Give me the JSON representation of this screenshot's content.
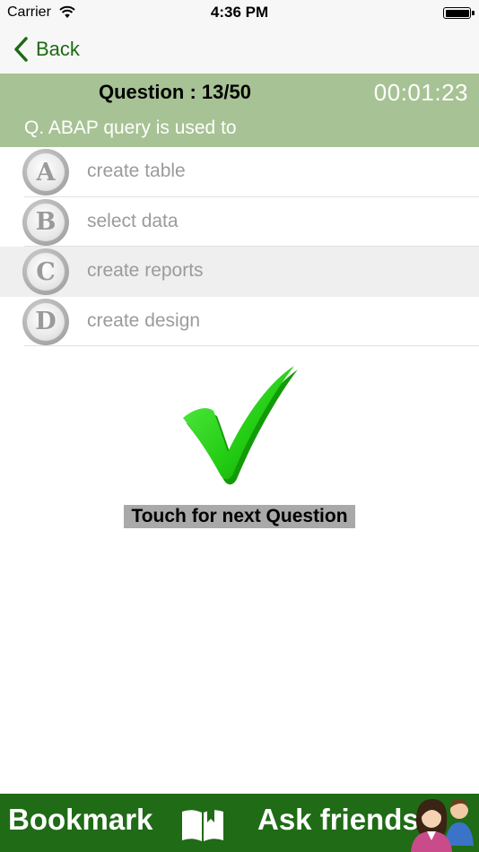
{
  "status_bar": {
    "carrier": "Carrier",
    "time": "4:36 PM",
    "icons": [
      "wifi-icon",
      "battery-icon"
    ]
  },
  "nav": {
    "back_label": "Back",
    "accent_color": "#1c6b13"
  },
  "header": {
    "counter": "Question : 13/50",
    "timer": "00:01:23",
    "question": "Q. ABAP query is used to",
    "background_color": "#a7c294"
  },
  "options": [
    {
      "letter": "A",
      "text": "create table",
      "highlighted": false
    },
    {
      "letter": "B",
      "text": "select data",
      "highlighted": false
    },
    {
      "letter": "C",
      "text": "create reports",
      "highlighted": true
    },
    {
      "letter": "D",
      "text": "create design",
      "highlighted": false
    }
  ],
  "result": {
    "icon": "checkmark-icon",
    "color": "#2bd41a",
    "next_label": "Touch for next Question"
  },
  "bottom_bar": {
    "bookmark_label": "Bookmark",
    "bookmark_icon": "book-icon",
    "ask_label": "Ask friends",
    "ask_icon": "friends-icon",
    "background_color": "#1f6b16"
  }
}
